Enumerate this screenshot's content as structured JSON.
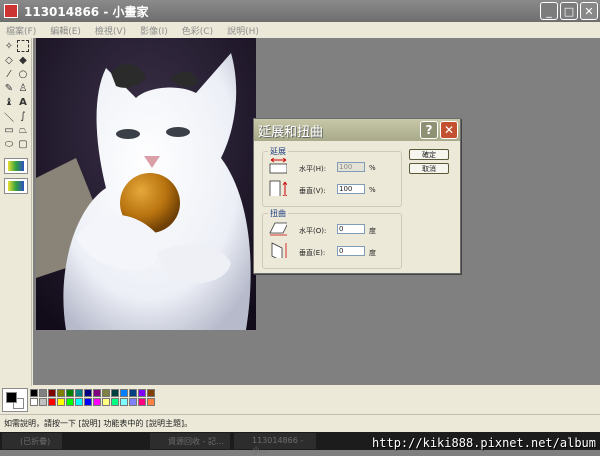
{
  "window": {
    "title": "113014866 - 小畫家",
    "minimize": "_",
    "maximize": "□",
    "close": "✕"
  },
  "menu": [
    "檔案(F)",
    "編輯(E)",
    "檢視(V)",
    "影像(I)",
    "色彩(C)",
    "說明(H)"
  ],
  "dialog": {
    "title": "延展和扭曲",
    "help_button": "?",
    "close_button": "✕",
    "stretch_group": "延展",
    "stretch_horizontal_label": "水平(H):",
    "stretch_horizontal_value": "100",
    "stretch_vertical_label": "垂直(V):",
    "stretch_vertical_value": "100",
    "percent_unit": "%",
    "skew_group": "扭曲",
    "skew_horizontal_label": "水平(O):",
    "skew_horizontal_value": "0",
    "skew_vertical_label": "垂直(E):",
    "skew_vertical_value": "0",
    "degree_unit": "度",
    "ok_button": "確定",
    "cancel_button": "取消"
  },
  "palette": [
    "#000000",
    "#808080",
    "#800000",
    "#808000",
    "#008000",
    "#008080",
    "#000080",
    "#800080",
    "#808040",
    "#004040",
    "#0080ff",
    "#004080",
    "#8000ff",
    "#804000",
    "#ffffff",
    "#c0c0c0",
    "#ff0000",
    "#ffff00",
    "#00ff00",
    "#00ffff",
    "#0000ff",
    "#ff00ff",
    "#ffff80",
    "#00ff80",
    "#80ffff",
    "#8080ff",
    "#ff0080",
    "#ff8040"
  ],
  "status": "如需說明，請按一下 [說明] 功能表中的 [說明主題]。",
  "taskbar": {
    "item1": "(已折疊)",
    "item2": "資源回收 - 記…",
    "item3": "113014866 - 小…"
  },
  "watermark": "http://kiki888.pixnet.net/album"
}
